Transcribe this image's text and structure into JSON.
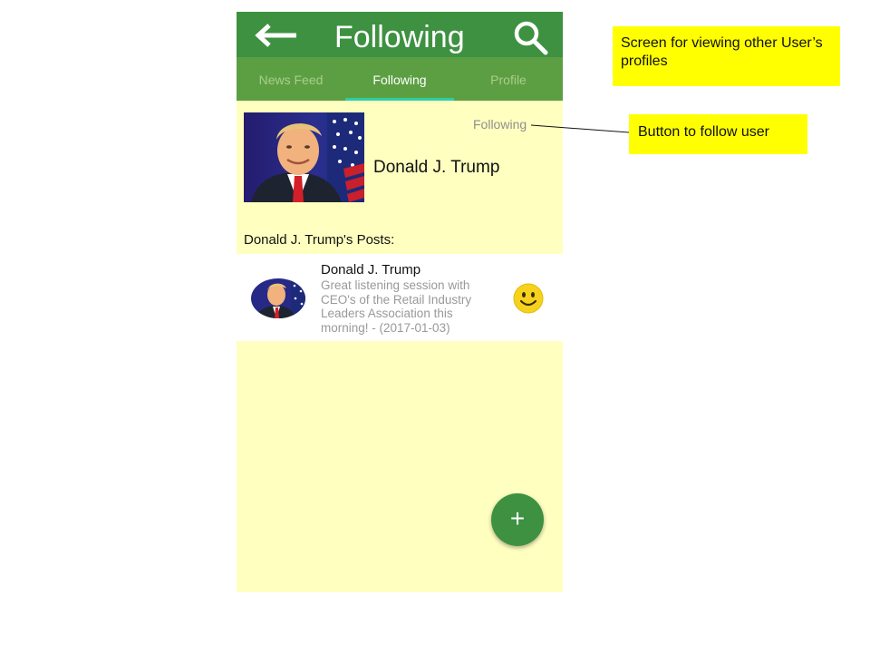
{
  "header": {
    "title": "Following",
    "back_icon": "back-arrow-icon",
    "search_icon": "search-icon"
  },
  "tabs": [
    {
      "label": "News Feed",
      "active": false
    },
    {
      "label": "Following",
      "active": true
    },
    {
      "label": "Profile",
      "active": false
    }
  ],
  "profile": {
    "name": "Donald J. Trump",
    "follow_label": "Following"
  },
  "posts_heading": "Donald J. Trump's Posts:",
  "post": {
    "author": "Donald J. Trump",
    "text": "Great listening session with CEO's of the Retail Industry Leaders Association this morning! - (2017-01-03)",
    "reaction_icon": "smiley-face-icon"
  },
  "fab": {
    "label": "+"
  },
  "annotations": {
    "screen_note": "Screen for viewing other User’s profiles",
    "button_note": "Button to follow user"
  },
  "colors": {
    "app_bar": "#3d9140",
    "tab_bar": "#5c9f43",
    "tab_indicator": "#2ecfa5",
    "background": "#ffffc0",
    "annotation": "#ffff00"
  }
}
